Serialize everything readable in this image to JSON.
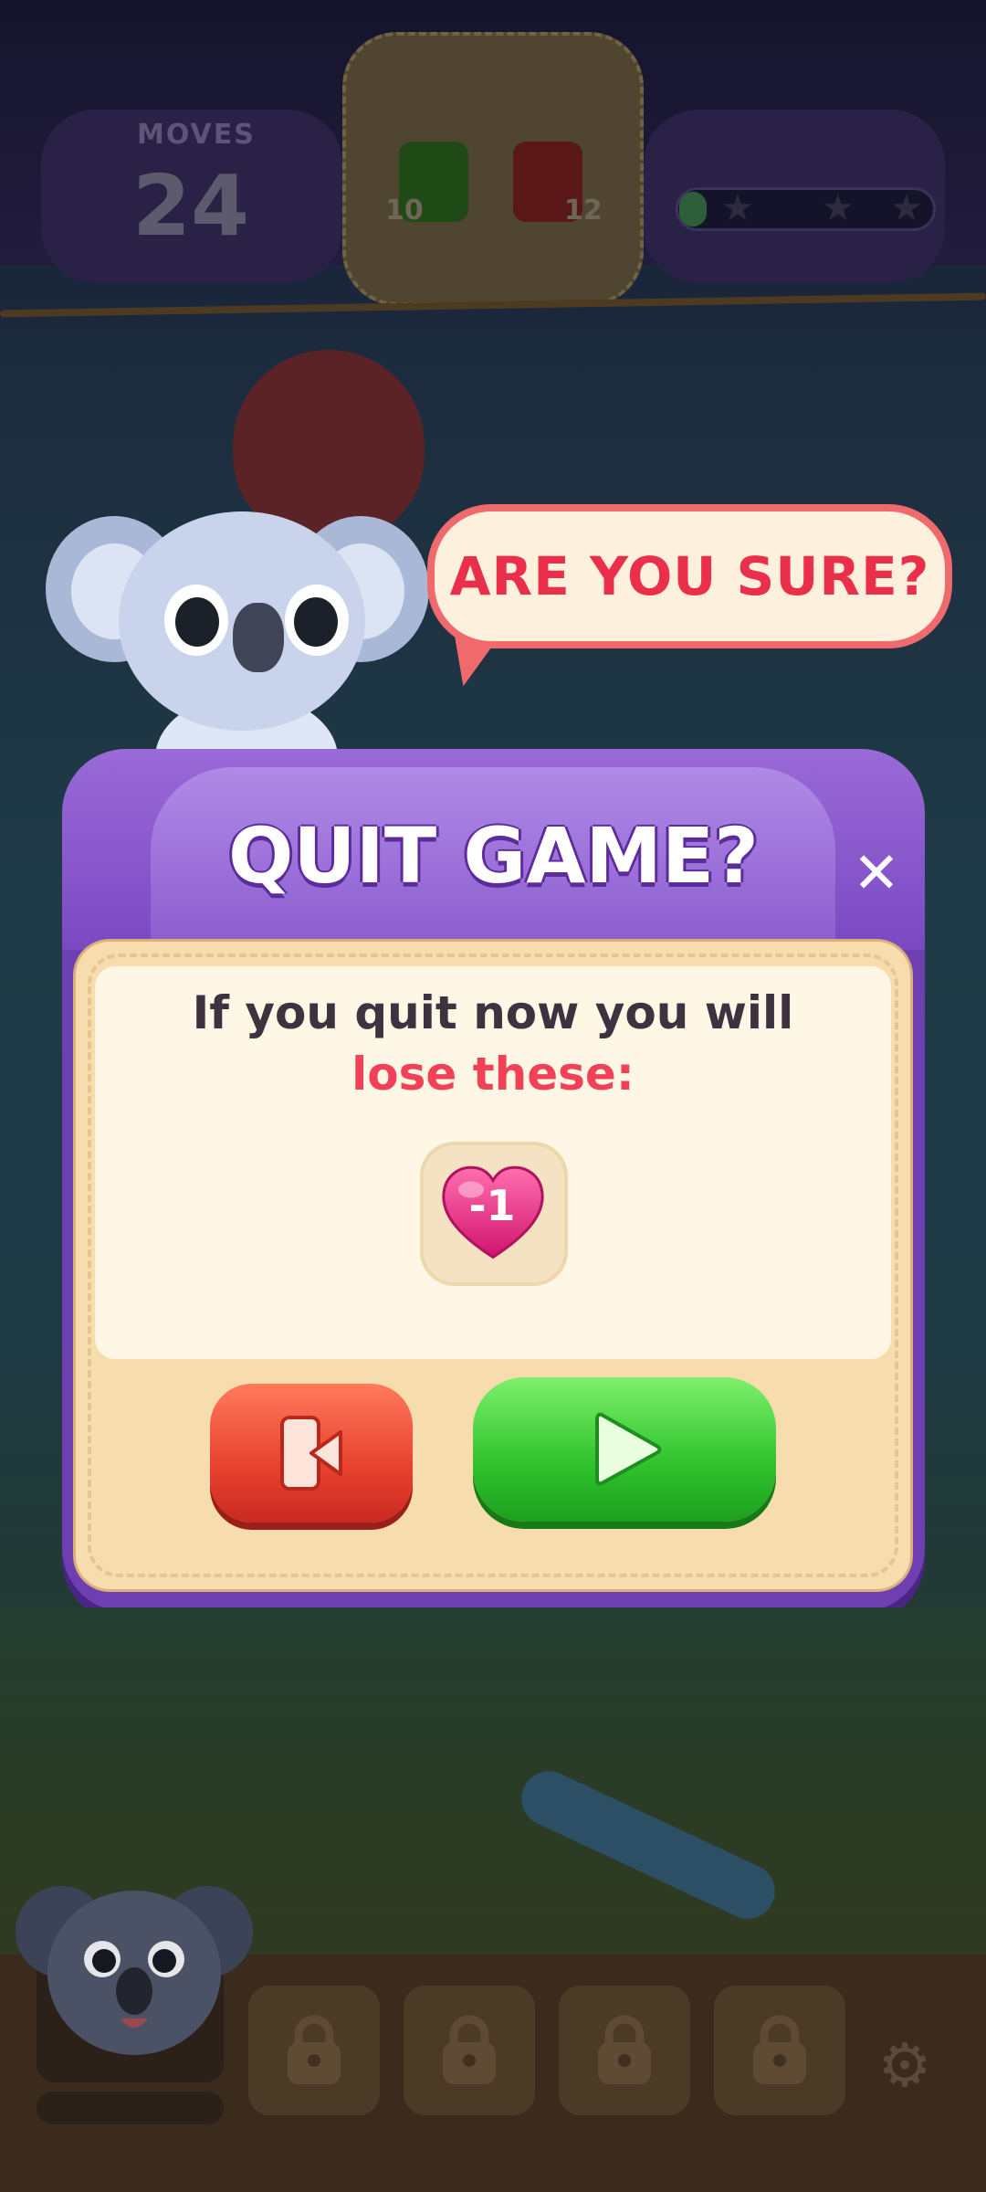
{
  "hud": {
    "moves_label": "MOVES",
    "moves_value": "24",
    "goals": [
      {
        "color": "green",
        "count": "10"
      },
      {
        "color": "red",
        "count": "12"
      }
    ],
    "progress_fraction": 0.05,
    "stars": 3
  },
  "bubble": {
    "text": "ARE YOU SURE?"
  },
  "dialog": {
    "title": "QUIT GAME?",
    "close_icon": "close-icon",
    "message_line1": "If you quit now you will",
    "message_line2": "lose these:",
    "loss_item": {
      "icon": "heart-icon",
      "label": "-1"
    },
    "quit_button_icon": "exit-icon",
    "play_button_icon": "play-icon"
  },
  "bottom": {
    "locked_slots": 4,
    "settings_icon": "gear-icon"
  },
  "colors": {
    "dialog_purple": "#6d3fb1",
    "accent_red": "#f04157",
    "play_green": "#2fc32d",
    "quit_red": "#e8412f"
  }
}
